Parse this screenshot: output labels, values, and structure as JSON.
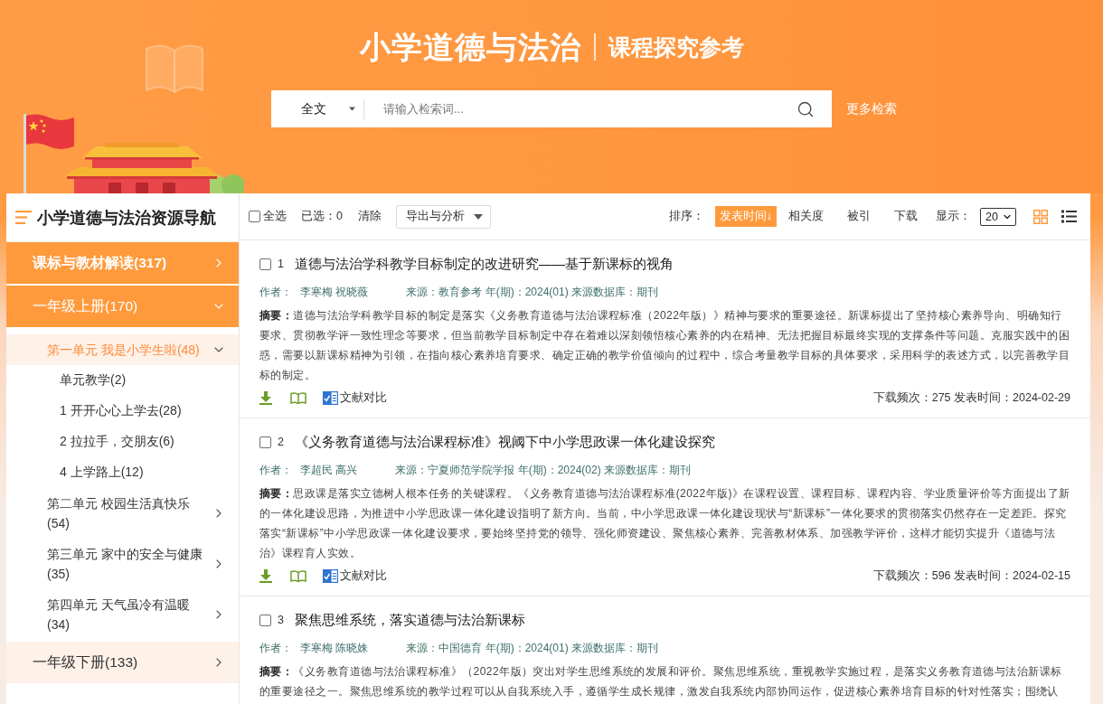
{
  "header": {
    "title": "小学道德与法治",
    "subtitle": "课程探究参考",
    "search": {
      "scope": "全文",
      "placeholder": "请输入检索词...",
      "more_link": "更多检索"
    }
  },
  "sidebar": {
    "title": "小学道德与法治资源导航",
    "items": [
      {
        "label": "课标与教材解读(317)",
        "selected": true,
        "expanded": false
      },
      {
        "label": "一年级上册(170)",
        "selected": false,
        "expanded": true,
        "children": [
          {
            "label": "第一单元 我是小学生啦(48)",
            "expanded": true,
            "children": [
              {
                "label": "单元教学(2)"
              },
              {
                "label": "1 开开心心上学去(28)"
              },
              {
                "label": "2 拉拉手，交朋友(6)"
              },
              {
                "label": "4 上学路上(12)"
              }
            ]
          },
          {
            "label": "第二单元 校园生活真快乐(54)",
            "expanded": false
          },
          {
            "label": "第三单元 家中的安全与健康(35)",
            "expanded": false
          },
          {
            "label": "第四单元 天气虽冷有温暖(34)",
            "expanded": false
          }
        ]
      },
      {
        "label": "一年级下册(133)",
        "selected": false,
        "expanded": false
      }
    ]
  },
  "toolbar": {
    "select_all": {
      "label": "全选",
      "checked": false
    },
    "selected_count": "已选：0",
    "clear": "清除",
    "export": "导出与分析",
    "sort_label": "排序：",
    "sort_options": [
      {
        "label": "发表时间↓",
        "selected": true
      },
      {
        "label": "相关度",
        "selected": false
      },
      {
        "label": "被引",
        "selected": false
      },
      {
        "label": "下载",
        "selected": false
      }
    ],
    "display_label": "显示：",
    "page_size": "20",
    "views": [
      {
        "kind": "grid",
        "selected": true
      },
      {
        "kind": "list",
        "selected": false
      }
    ]
  },
  "results": [
    {
      "number": "1",
      "checked": false,
      "title": "道德与法治学科教学目标制定的改进研究——基于新课标的视角",
      "author_label": "作者：",
      "authors": "李寒梅 祝晓薇",
      "source": "来源：教育参考 年(期)：2024(01) 来源数据库：期刊",
      "abstract": "**摘要：**道德与法治学科教学目标的制定是落实《义务教育道德与法治课程标准（2022年版）》精神与要求的重要途径。新课标提出了坚持核心素养导向、明确知行要求、贯彻教学评一致性理念等要求，但当前教学目标制定中存在着难以深刻领悟核心素养的内在精神、无法把握目标最终实现的支撑条件等问题。克服实践中的困惑，需要以新课标精神为引领，在指向核心素养培育要求、确定正确的教学价值倾向的过程中，综合考量教学目标的具体要求，采用科学的表述方式，以完善教学目标的制定。",
      "compare": "文献对比",
      "stats": "下载频次：275 发表时间：2024-02-29"
    },
    {
      "number": "2",
      "checked": false,
      "title": "《义务教育道德与法治课程标准》视阈下中小学思政课一体化建设探究",
      "author_label": "作者：",
      "authors": "李超民 高兴",
      "source": "来源：宁夏师范学院学报 年(期)：2024(02) 来源数据库：期刊",
      "abstract": "**摘要：**思政课是落实立德树人根本任务的关键课程。《义务教育道德与法治课程标准(2022年版)》在课程设置、课程目标、课程内容、学业质量评价等方面提出了新的一体化建设思路，为推进中小学思政课一体化建设指明了新方向。当前，中小学思政课一体化建设现状与“新课标”一体化要求的贯彻落实仍然存在一定差距。探究落实“新课标”中小学思政课一体化建设要求，要始终坚持党的领导、强化师资建设、聚焦核心素养、完善教材体系、加强教学评价，这样才能切实提升《道德与法治》课程育人实效。",
      "compare": "文献对比",
      "stats": "下载频次：596 发表时间：2024-02-15"
    },
    {
      "number": "3",
      "checked": false,
      "title": "聚焦思维系统，落实道德与法治新课标",
      "author_label": "作者：",
      "authors": "李寒梅 陈晓姝",
      "source": "来源：中国德育 年(期)：2024(01) 来源数据库：期刊",
      "abstract": "**摘要：**《义务教育道德与法治课程标准》（2022年版）突出对学生思维系统的发展和评价。聚焦思维系统，重视教学实施过程，是落实义务教育道德与法治新课标的重要途径之一。聚焦思维系统的教学过程可以从自我系统入手，遵循学生成长规律，激发自我系统内部协同运作，促进核心素养培育目标的针对性落实；围绕认"
    }
  ]
}
